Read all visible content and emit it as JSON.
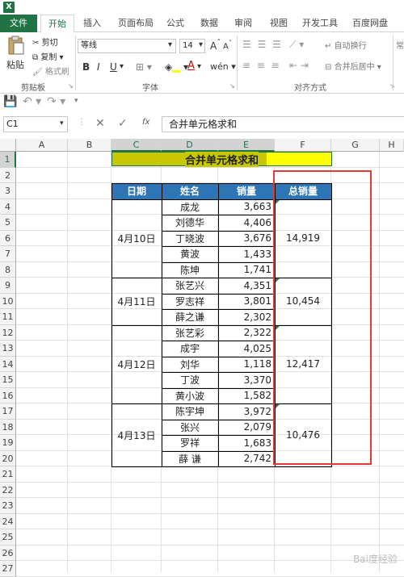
{
  "ribbon_tabs": [
    "文件",
    "开始",
    "插入",
    "页面布局",
    "公式",
    "数据",
    "审阅",
    "视图",
    "开发工具",
    "百度网盘"
  ],
  "clipboard": {
    "paste": "粘贴",
    "cut": "剪切",
    "copy": "复制",
    "format_painter": "格式刷",
    "group": "剪贴板"
  },
  "font": {
    "name": "等线",
    "size": "14",
    "bold": "B",
    "italic": "I",
    "underline": "U",
    "group": "字体"
  },
  "alignment": {
    "wrap": "自动换行",
    "merge": "合并后居中",
    "group": "对齐方式",
    "extra": "常"
  },
  "formula_bar": {
    "name_box": "C1",
    "fx": "fx",
    "value": "合并单元格求和"
  },
  "columns": [
    "A",
    "B",
    "C",
    "D",
    "E",
    "F",
    "G",
    "H"
  ],
  "rows": [
    "1",
    "2",
    "3",
    "4",
    "5",
    "6",
    "7",
    "8",
    "9",
    "10",
    "11",
    "12",
    "13",
    "14",
    "15",
    "16",
    "17",
    "18",
    "19",
    "20",
    "21",
    "22",
    "23",
    "24",
    "25",
    "26",
    "27"
  ],
  "sheet": {
    "title": "合并单元格求和",
    "headers": [
      "日期",
      "姓名",
      "销量",
      "总销量"
    ],
    "groups": [
      {
        "date": "4月10日",
        "total": "14,919",
        "items": [
          [
            "成龙",
            "3,663"
          ],
          [
            "刘德华",
            "4,406"
          ],
          [
            "丁晓波",
            "3,676"
          ],
          [
            "黄波",
            "1,433"
          ],
          [
            "陈坤",
            "1,741"
          ]
        ]
      },
      {
        "date": "4月11日",
        "total": "10,454",
        "items": [
          [
            "张艺兴",
            "4,351"
          ],
          [
            "罗志祥",
            "3,801"
          ],
          [
            "薛之谦",
            "2,302"
          ]
        ]
      },
      {
        "date": "4月12日",
        "total": "12,417",
        "items": [
          [
            "张艺彩",
            "2,322"
          ],
          [
            "成宇",
            "4,025"
          ],
          [
            "刘华",
            "1,118"
          ],
          [
            "丁波",
            "3,370"
          ],
          [
            "黄小波",
            "1,582"
          ]
        ]
      },
      {
        "date": "4月13日",
        "total": "10,476",
        "items": [
          [
            "陈宇坤",
            "3,972"
          ],
          [
            "张兴",
            "2,079"
          ],
          [
            "罗祥",
            "1,683"
          ],
          [
            "薛 谦",
            "2,742"
          ]
        ]
      }
    ]
  },
  "colors": {
    "excel_green": "#217346",
    "title_fill": "#FFFF00",
    "title_fill_dark": "#C8C800",
    "header_fill": "#2E75B6",
    "highlight": "#E53935"
  },
  "watermark": "Bai度经验"
}
